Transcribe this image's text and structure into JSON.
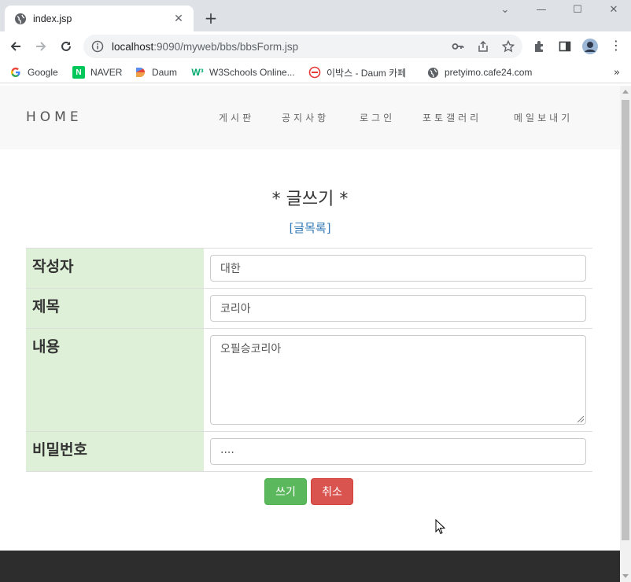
{
  "browser": {
    "tab_title": "index.jsp",
    "tab_close": "✕",
    "new_tab": "+",
    "window_controls": [
      "⌄",
      "—",
      "☐",
      "✕"
    ],
    "url_host": "localhost",
    "url_rest": ":9090/myweb/bbs/bbsForm.jsp",
    "bookmarks": [
      {
        "label": "Google"
      },
      {
        "label": "NAVER"
      },
      {
        "label": "Daum"
      },
      {
        "label": "W3Schools Online..."
      },
      {
        "label": "이박스 - Daum 카페"
      },
      {
        "label": "pretyimo.cafe24.com"
      }
    ],
    "bookmarks_more": "»"
  },
  "site": {
    "brand": "HOME",
    "menu": [
      "게시판",
      "공지사항",
      "로그인",
      "포토갤러리",
      "메일보내기"
    ]
  },
  "form": {
    "title": "* 글쓰기 *",
    "list_link": "[글목록]",
    "fields": {
      "writer_label": "작성자",
      "writer_value": "대한",
      "subject_label": "제목",
      "subject_value": "코리아",
      "content_label": "내용",
      "content_value": "오필승코리아",
      "password_label": "비밀번호",
      "password_value": "...."
    },
    "submit_label": "쓰기",
    "cancel_label": "취소"
  },
  "colors": {
    "label_bg": "#dff0d8",
    "submit": "#5cb85c",
    "cancel": "#d9534f",
    "link": "#337ab7",
    "footer": "#2d2d2d"
  }
}
